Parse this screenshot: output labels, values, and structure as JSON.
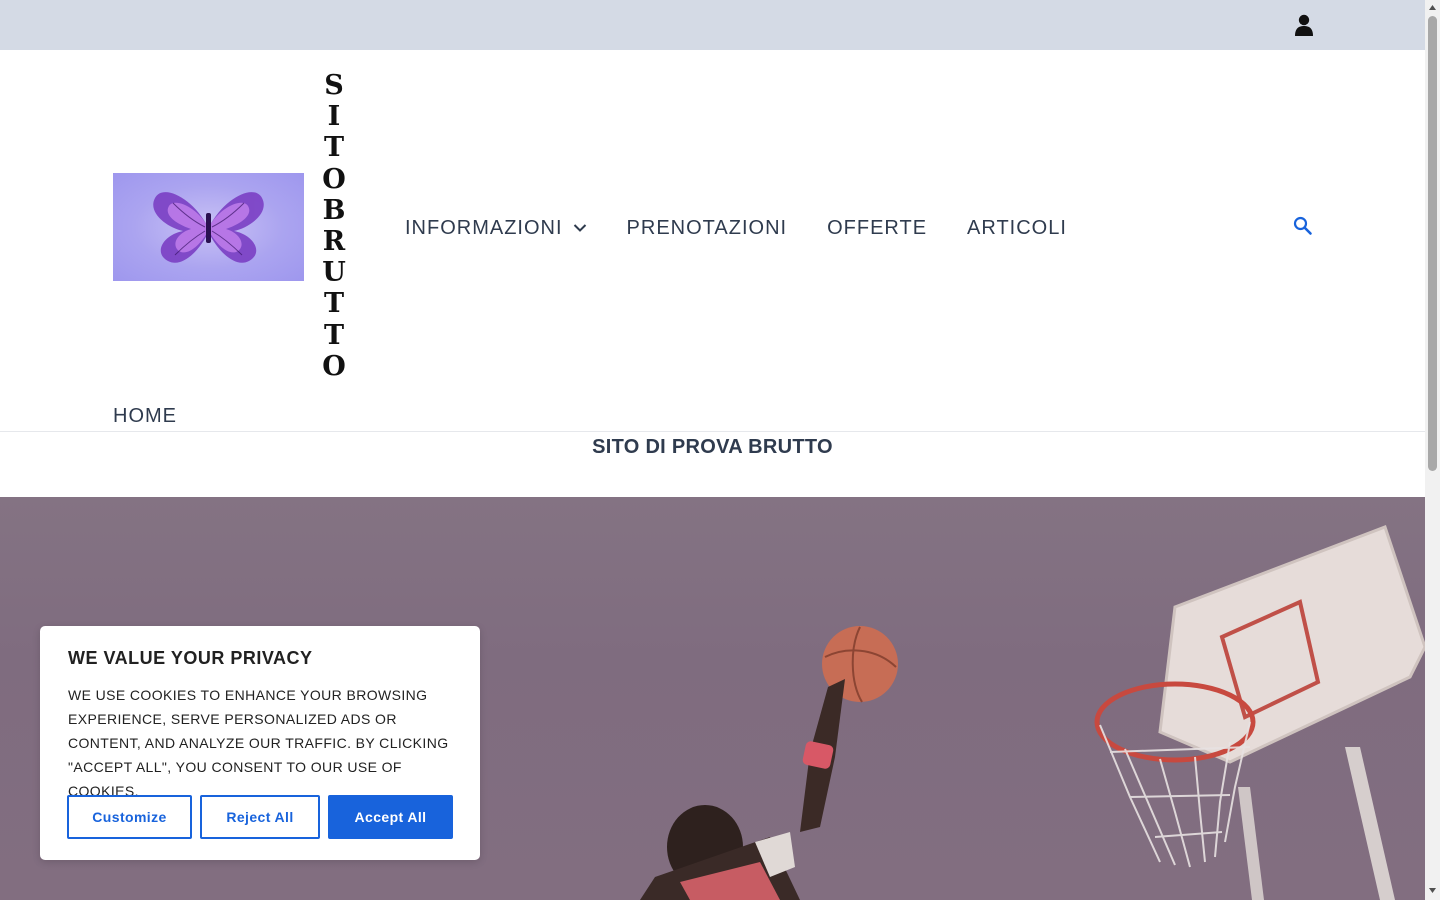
{
  "topbar": {
    "account_icon": "user-icon"
  },
  "header": {
    "site_title": "SITOBRUTTO",
    "logo_icon": "butterfly-logo",
    "nav": [
      {
        "label": "INFORMAZIONI",
        "has_dropdown": true
      },
      {
        "label": "PRENOTAZIONI"
      },
      {
        "label": "OFFERTE"
      },
      {
        "label": "ARTICOLI"
      }
    ],
    "home_label": "HOME",
    "search_icon": "search-icon"
  },
  "page": {
    "heading": "SITO DI PROVA BRUTTO"
  },
  "hero": {
    "image": "basketball-dunk-photo"
  },
  "cookie_banner": {
    "title": "WE VALUE YOUR PRIVACY",
    "text": "WE USE COOKIES TO ENHANCE YOUR BROWSING EXPERIENCE, SERVE PERSONALIZED ADS OR CONTENT, AND ANALYZE OUR TRAFFIC. BY CLICKING \"ACCEPT ALL\", YOU CONSENT TO OUR USE OF COOKIES.",
    "buttons": {
      "customize": "Customize",
      "reject": "Reject All",
      "accept": "Accept All"
    }
  },
  "colors": {
    "topbar": "#d4dae5",
    "nav_text": "#2f3b4e",
    "accent": "#1863dc",
    "hero_tint": "#7f6c7f"
  }
}
